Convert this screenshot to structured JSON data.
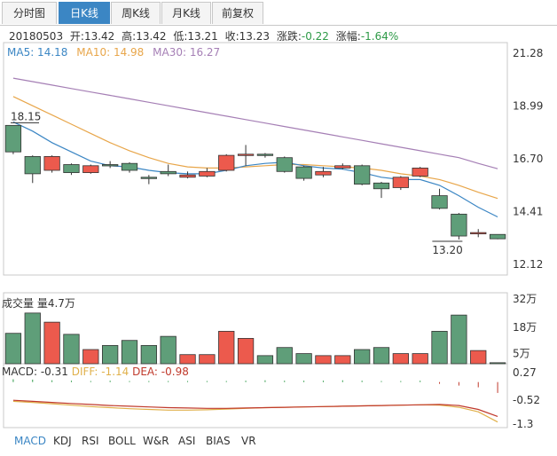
{
  "tabs": [
    {
      "label": "分时图",
      "active": false
    },
    {
      "label": "日K线",
      "active": true
    },
    {
      "label": "周K线",
      "active": false
    },
    {
      "label": "月K线",
      "active": false
    },
    {
      "label": "前复权",
      "active": false
    }
  ],
  "info": {
    "date": "20180503",
    "open_label": "开:",
    "open": "13.42",
    "high_label": "高:",
    "high": "13.42",
    "low_label": "低:",
    "low": "13.21",
    "close_label": "收:",
    "close": "13.23",
    "change_label": "涨跌:",
    "change": "-0.22",
    "pct_label": "涨幅:",
    "pct": "-1.64%"
  },
  "ma_legend": {
    "ma5": "MA5: 14.18",
    "ma10": "MA10: 14.98",
    "ma30": "MA30: 16.27"
  },
  "colors": {
    "up": "#ec5a4d",
    "down": "#5f9e79",
    "ma5": "#3b86c4",
    "ma10": "#e8a64a",
    "ma30": "#a57fb5",
    "diff": "#e0b04a",
    "dea": "#c0392b"
  },
  "volume_label": "成交量 量4.7万",
  "macd_label": {
    "macd": "MACD: -0.31",
    "diff": "DIFF: -1.14",
    "dea": "DEA: -0.98"
  },
  "bottom_tabs": [
    {
      "label": "MACD",
      "active": true
    },
    {
      "label": "KDJ",
      "active": false
    },
    {
      "label": "RSI",
      "active": false
    },
    {
      "label": "BOLL",
      "active": false
    },
    {
      "label": "W&R",
      "active": false
    },
    {
      "label": "ASI",
      "active": false
    },
    {
      "label": "BIAS",
      "active": false
    },
    {
      "label": "VR",
      "active": false
    }
  ],
  "chart_data": {
    "type": "candlestick",
    "price_axis": {
      "ticks": [
        "21.28",
        "18.99",
        "16.70",
        "14.41",
        "12.12"
      ],
      "range": [
        12.12,
        21.28
      ]
    },
    "volume_axis": {
      "ticks": [
        "32万",
        "18万",
        "5万"
      ],
      "range": [
        0,
        35
      ]
    },
    "macd_axis": {
      "ticks": [
        "0.27",
        "-0.52",
        "-1.3"
      ],
      "range": [
        -1.3,
        0.27
      ]
    },
    "annotations": {
      "high_mark": "18.15",
      "low_mark": "13.20"
    },
    "candles": [
      {
        "o": 18.15,
        "c": 17.0,
        "h": 18.15,
        "l": 16.9
      },
      {
        "o": 16.8,
        "c": 16.05,
        "h": 16.85,
        "l": 15.65
      },
      {
        "o": 16.2,
        "c": 16.8,
        "h": 16.85,
        "l": 16.1
      },
      {
        "o": 16.45,
        "c": 16.1,
        "h": 16.5,
        "l": 16.0
      },
      {
        "o": 16.1,
        "c": 16.4,
        "h": 16.45,
        "l": 16.05
      },
      {
        "o": 16.45,
        "c": 16.4,
        "h": 16.6,
        "l": 16.3
      },
      {
        "o": 16.5,
        "c": 16.2,
        "h": 16.55,
        "l": 16.1
      },
      {
        "o": 15.9,
        "c": 15.85,
        "h": 16.0,
        "l": 15.6
      },
      {
        "o": 16.15,
        "c": 16.05,
        "h": 16.45,
        "l": 15.95
      },
      {
        "o": 15.9,
        "c": 16.0,
        "h": 16.15,
        "l": 15.85
      },
      {
        "o": 15.95,
        "c": 16.15,
        "h": 16.3,
        "l": 15.9
      },
      {
        "o": 16.2,
        "c": 16.85,
        "h": 16.9,
        "l": 16.15
      },
      {
        "o": 16.85,
        "c": 16.9,
        "h": 17.3,
        "l": 16.4
      },
      {
        "o": 16.9,
        "c": 16.85,
        "h": 16.95,
        "l": 16.75
      },
      {
        "o": 16.75,
        "c": 16.15,
        "h": 16.8,
        "l": 16.1
      },
      {
        "o": 16.35,
        "c": 15.85,
        "h": 16.4,
        "l": 15.75
      },
      {
        "o": 16.0,
        "c": 16.15,
        "h": 16.35,
        "l": 15.9
      },
      {
        "o": 16.3,
        "c": 16.4,
        "h": 16.5,
        "l": 16.25
      },
      {
        "o": 16.4,
        "c": 15.6,
        "h": 16.45,
        "l": 15.55
      },
      {
        "o": 15.65,
        "c": 15.4,
        "h": 15.7,
        "l": 15.0
      },
      {
        "o": 15.45,
        "c": 15.9,
        "h": 15.95,
        "l": 15.35
      },
      {
        "o": 15.95,
        "c": 16.3,
        "h": 16.35,
        "l": 15.9
      },
      {
        "o": 15.1,
        "c": 14.55,
        "h": 15.4,
        "l": 14.5
      },
      {
        "o": 14.3,
        "c": 13.35,
        "h": 14.35,
        "l": 13.2
      },
      {
        "o": 13.45,
        "c": 13.5,
        "h": 13.65,
        "l": 13.3
      },
      {
        "o": 13.42,
        "c": 13.23,
        "h": 13.42,
        "l": 13.21
      }
    ],
    "ma5": [
      18.3,
      17.9,
      17.4,
      17.0,
      16.6,
      16.4,
      16.35,
      16.2,
      16.1,
      16.05,
      16.05,
      16.2,
      16.4,
      16.5,
      16.55,
      16.4,
      16.3,
      16.25,
      16.1,
      15.9,
      15.8,
      15.8,
      15.55,
      15.1,
      14.6,
      14.18
    ],
    "ma10": [
      19.4,
      19.0,
      18.6,
      18.2,
      17.8,
      17.4,
      17.05,
      16.75,
      16.5,
      16.35,
      16.3,
      16.3,
      16.35,
      16.4,
      16.45,
      16.45,
      16.4,
      16.35,
      16.3,
      16.2,
      16.05,
      15.95,
      15.8,
      15.55,
      15.25,
      14.98
    ],
    "ma30": [
      20.2,
      20.05,
      19.9,
      19.75,
      19.6,
      19.45,
      19.3,
      19.15,
      19.0,
      18.85,
      18.7,
      18.55,
      18.4,
      18.25,
      18.1,
      17.95,
      17.8,
      17.65,
      17.5,
      17.35,
      17.2,
      17.05,
      16.9,
      16.75,
      16.5,
      16.27
    ],
    "volume": [
      15,
      25,
      20.5,
      14.5,
      7,
      9,
      11.5,
      9,
      13.5,
      4.5,
      4.5,
      16,
      12.5,
      4,
      8,
      5,
      4,
      4,
      7,
      8,
      5,
      5,
      16,
      24,
      6.5,
      0.5
    ],
    "macd_hist": [
      0.08,
      0.07,
      0.05,
      0.04,
      0.03,
      0.04,
      0.03,
      0.03,
      0.03,
      0.03,
      0.03,
      0.03,
      0.04,
      0.05,
      0.04,
      0.04,
      0.04,
      0.05,
      0.04,
      0.03,
      0.03,
      0.04,
      -0.05,
      -0.1,
      -0.15,
      -0.31
    ],
    "diff": [
      -0.55,
      -0.58,
      -0.62,
      -0.66,
      -0.7,
      -0.73,
      -0.76,
      -0.78,
      -0.8,
      -0.8,
      -0.79,
      -0.77,
      -0.75,
      -0.73,
      -0.72,
      -0.71,
      -0.7,
      -0.69,
      -0.68,
      -0.67,
      -0.66,
      -0.65,
      -0.66,
      -0.72,
      -0.85,
      -1.14
    ],
    "dea": [
      -0.52,
      -0.55,
      -0.58,
      -0.61,
      -0.64,
      -0.67,
      -0.69,
      -0.71,
      -0.73,
      -0.74,
      -0.75,
      -0.75,
      -0.74,
      -0.73,
      -0.72,
      -0.71,
      -0.7,
      -0.69,
      -0.68,
      -0.67,
      -0.66,
      -0.65,
      -0.64,
      -0.67,
      -0.78,
      -0.98
    ]
  }
}
